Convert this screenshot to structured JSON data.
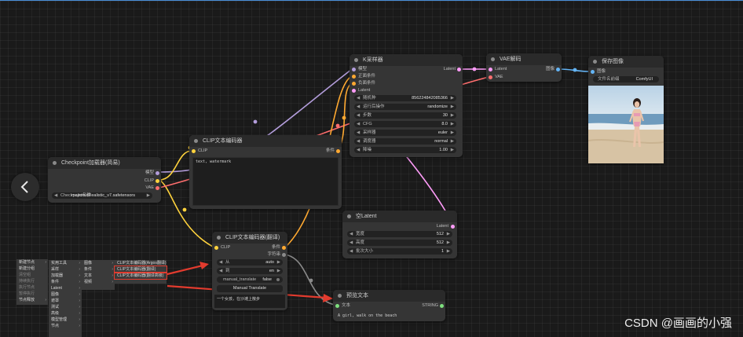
{
  "colors": {
    "clip": "#ffd33d",
    "model": "#b39ddb",
    "latent": "#ff9cf9",
    "vae": "#ff6e6e",
    "conditioning": "#ffa931",
    "image": "#64b5f6",
    "string": "#7ee07e"
  },
  "nodes": {
    "checkpoint": {
      "title": "Checkpoint加载器(简易)",
      "outputs": [
        "模型",
        "CLIP",
        "VAE"
      ],
      "ckpt_label": "Checkpoint名称",
      "ckpt_value": "majicmixRealistic_v7.safetensors"
    },
    "clip_neg": {
      "title": "CLIP文本编码器",
      "input": "CLIP",
      "output": "条件",
      "text": "text, watermark"
    },
    "clip_translate": {
      "title": "CLIP文本编码器(翻译)",
      "input": "CLIP",
      "outputs": [
        "条件",
        "字符串"
      ],
      "from_label": "从",
      "from_value": "auto",
      "to_label": "到",
      "to_value": "en",
      "manual_label": "manual_translate",
      "manual_value": "false",
      "button": "Manual Translate",
      "text": "一个女孩，在沙滩上散步"
    },
    "ksampler": {
      "title": "K采样器",
      "inputs": [
        "模型",
        "正面条件",
        "负面条件",
        "Latent"
      ],
      "output": "Latent",
      "widgets": [
        {
          "label": "随机种",
          "value": "856224842085366"
        },
        {
          "label": "运行后操作",
          "value": "randomize"
        },
        {
          "label": "步数",
          "value": "30"
        },
        {
          "label": "CFG",
          "value": "8.0"
        },
        {
          "label": "采样器",
          "value": "euler"
        },
        {
          "label": "调度器",
          "value": "normal"
        },
        {
          "label": "降噪",
          "value": "1.00"
        }
      ]
    },
    "vae_decode": {
      "title": "VAE解码",
      "inputs": [
        "Latent",
        "VAE"
      ],
      "output": "图像"
    },
    "save_image": {
      "title": "保存图像",
      "input": "图像",
      "prefix_label": "文件名前缀",
      "prefix_value": "ComfyUI"
    },
    "empty_latent": {
      "title": "空Latent",
      "output": "Latent",
      "widgets": [
        {
          "label": "宽度",
          "value": "512"
        },
        {
          "label": "高度",
          "value": "512"
        },
        {
          "label": "批次大小",
          "value": "1"
        }
      ]
    },
    "preview_text": {
      "title": "预览文本",
      "input": "文本",
      "output": "STRING",
      "text": "A girl, walk on the beach"
    }
  },
  "context_menu": {
    "col1": [
      "新建节点",
      "新建分组",
      "清空组",
      "持续执行",
      "执行节点",
      "暂停执行",
      "节点释放"
    ],
    "col2": [
      "实用工具",
      "采样",
      "加载器",
      "条件",
      "Latent",
      "图像",
      "遮罩",
      "测试",
      "高级",
      "模型管理",
      "节点"
    ],
    "col3": [
      "图像",
      "条件",
      "文本",
      "视频"
    ],
    "col4": [
      "CLIP文本编码器(Argos翻译)",
      "CLIP文本编码器(翻译)",
      "CLIP文本编码器(翻译高级)"
    ]
  },
  "watermark": "CSDN @画画的小强"
}
